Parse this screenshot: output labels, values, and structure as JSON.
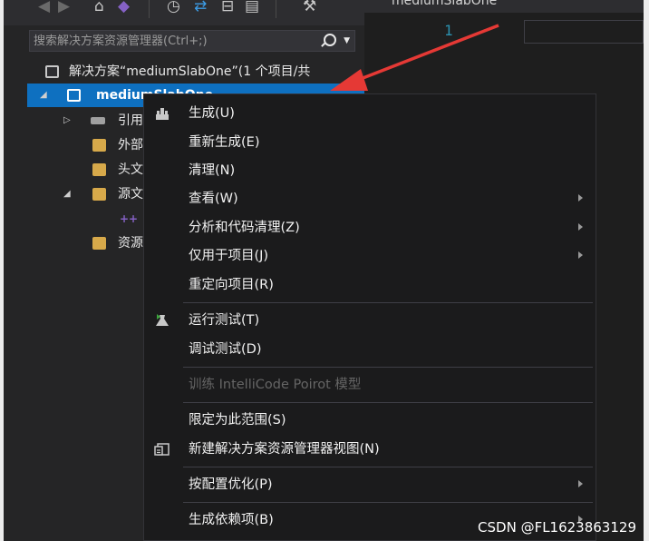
{
  "solution_explorer": {
    "search_placeholder": "搜索解决方案资源管理器(Ctrl+;)",
    "tree": [
      {
        "label": "解决方案“mediumSlabOne”(1 个项目/共"
      },
      {
        "label": "mediumSlabOne"
      },
      {
        "label": "引用"
      },
      {
        "label": "外部"
      },
      {
        "label": "头文"
      },
      {
        "label": "源文"
      },
      {
        "label": "资源"
      }
    ]
  },
  "editor": {
    "tab_title": "mediumSlabOne",
    "line_number": "1"
  },
  "context_menu": {
    "items": [
      {
        "label": "生成(U)",
        "icon": "build-icon"
      },
      {
        "label": "重新生成(E)"
      },
      {
        "label": "清理(N)"
      },
      {
        "label": "查看(W)",
        "submenu": true
      },
      {
        "label": "分析和代码清理(Z)",
        "submenu": true
      },
      {
        "label": "仅用于项目(J)",
        "submenu": true
      },
      {
        "label": "重定向项目(R)"
      },
      {
        "label": "运行测试(T)",
        "icon": "flask-icon"
      },
      {
        "label": "调试测试(D)"
      },
      {
        "label": "训练 IntelliCode Poirot 模型",
        "disabled": true
      },
      {
        "label": "限定为此范围(S)"
      },
      {
        "label": "新建解决方案资源管理器视图(N)",
        "icon": "new-view-icon"
      },
      {
        "label": "按配置优化(P)",
        "submenu": true
      },
      {
        "label": "生成依赖项(B)",
        "submenu": true
      }
    ]
  },
  "watermark": "CSDN @FL1623863129",
  "colors": {
    "selection": "#0e70c0",
    "menu_bg": "#1b1b1c",
    "arrow": "#e53935",
    "accent_purple": "#8561c5"
  }
}
